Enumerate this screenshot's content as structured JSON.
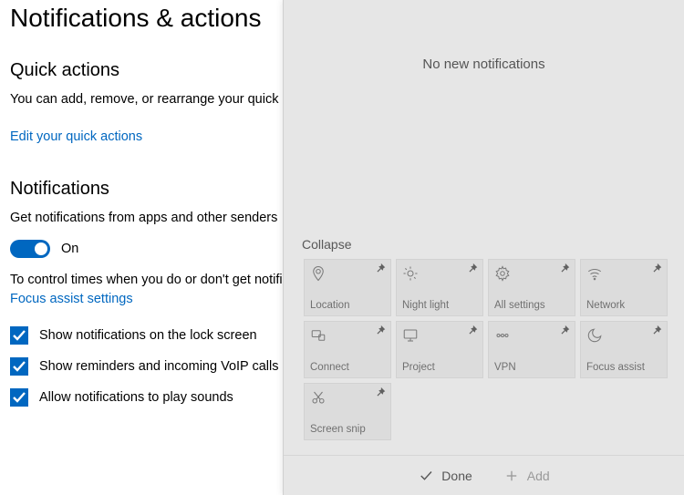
{
  "settings": {
    "page_title": "Notifications & actions",
    "quick_actions": {
      "heading": "Quick actions",
      "description": "You can add, remove, or rearrange your quick actions directly in action center.",
      "edit_link": "Edit your quick actions"
    },
    "notifications": {
      "heading": "Notifications",
      "get_notifs_label": "Get notifications from apps and other senders",
      "toggle_state": "On",
      "control_times_text": "To control times when you do or don't get notifications, try",
      "focus_link": "Focus assist settings",
      "options": [
        {
          "label": "Show notifications on the lock screen",
          "checked": true
        },
        {
          "label": "Show reminders and incoming VoIP calls on the lock screen",
          "checked": true
        },
        {
          "label": "Allow notifications to play sounds",
          "checked": true
        }
      ]
    }
  },
  "action_center": {
    "no_notifs": "No new notifications",
    "collapse_label": "Collapse",
    "tiles": [
      {
        "id": "location",
        "label": "Location",
        "icon": "location-icon"
      },
      {
        "id": "night-light",
        "label": "Night light",
        "icon": "night-light-icon"
      },
      {
        "id": "all-settings",
        "label": "All settings",
        "icon": "gear-icon"
      },
      {
        "id": "network",
        "label": "Network",
        "icon": "wifi-icon"
      },
      {
        "id": "connect",
        "label": "Connect",
        "icon": "connect-icon"
      },
      {
        "id": "project",
        "label": "Project",
        "icon": "project-icon"
      },
      {
        "id": "vpn",
        "label": "VPN",
        "icon": "vpn-icon"
      },
      {
        "id": "focus-assist",
        "label": "Focus assist",
        "icon": "moon-icon"
      },
      {
        "id": "screen-snip",
        "label": "Screen snip",
        "icon": "snip-icon"
      }
    ],
    "footer": {
      "done": "Done",
      "add": "Add"
    }
  }
}
